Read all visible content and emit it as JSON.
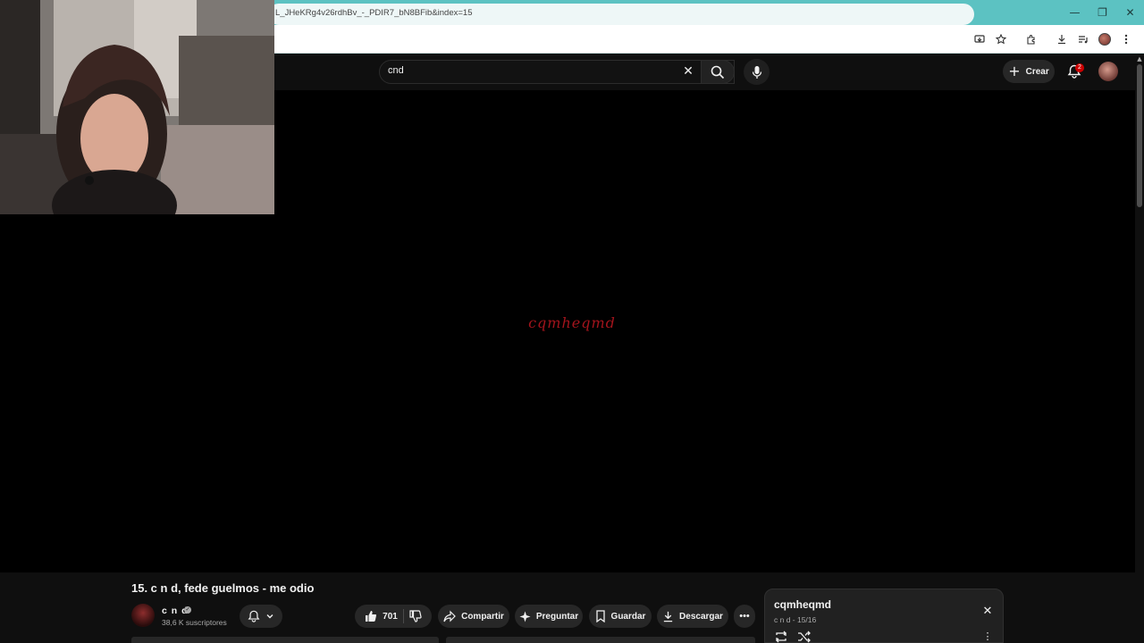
{
  "browser": {
    "url": "L_JHeKRg4v26rdhBv_-_PDIR7_bN8BFib&index=15",
    "chrome_color": "#5cc2c2",
    "window_controls": {
      "minimize": "—",
      "restore": "❐",
      "close": "✕"
    }
  },
  "header": {
    "search_value": "cnd",
    "create_label": "Crear",
    "notification_count": "2"
  },
  "video": {
    "title_art": "cqmheqmd",
    "art_color": "#a3141c"
  },
  "below": {
    "title": "15. c n d, fede guelmos - me odio",
    "channel_name": "c n d",
    "subscribers": "38,6 K suscriptores",
    "like_count": "701",
    "share_label": "Compartir",
    "ask_label": "Preguntar",
    "save_label": "Guardar",
    "download_label": "Descargar",
    "more_label": "•••"
  },
  "playlist": {
    "title": "cqmheqmd",
    "subtitle": "c n d - 15/16"
  },
  "icons": [
    "install-app-icon",
    "star-icon",
    "extensions-icon",
    "downloads-icon",
    "media-icon",
    "profile-icon",
    "menu-icon",
    "search-icon",
    "mic-icon",
    "bell-icon",
    "like-icon",
    "dislike-icon",
    "share-icon",
    "sparkle-icon",
    "bookmark-icon",
    "download-icon",
    "loop-icon",
    "shuffle-icon"
  ]
}
